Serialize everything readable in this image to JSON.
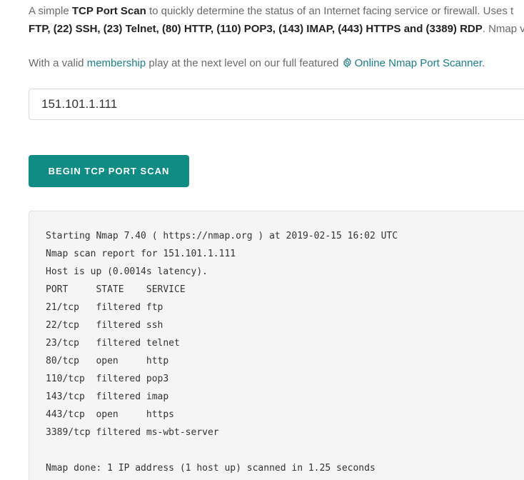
{
  "intro": {
    "t1": "A simple ",
    "b1": "TCP Port Scan",
    "t2": " to quickly determine the status of an Internet facing service or firewall. Uses t",
    "b2": "FTP, (22) SSH, (23) Telnet, (80) HTTP, (110) POP3, (143) IMAP, (443) HTTPS and (3389) RDP",
    "t3": ". Nmap ve"
  },
  "membership": {
    "t1": "With a valid ",
    "link": "membership",
    "t2": " play at the next level on our full featured ",
    "icon": "gear-icon",
    "scanner_link": "Online Nmap Port Scanner",
    "t3": "."
  },
  "target": {
    "value": "151.101.1.111"
  },
  "button": {
    "label": "BEGIN TCP PORT SCAN"
  },
  "output": {
    "lines": [
      "Starting Nmap 7.40 ( https://nmap.org ) at 2019-02-15 16:02 UTC",
      "Nmap scan report for 151.101.1.111",
      "Host is up (0.0014s latency).",
      "PORT     STATE    SERVICE",
      "21/tcp   filtered ftp",
      "22/tcp   filtered ssh",
      "23/tcp   filtered telnet",
      "80/tcp   open     http",
      "110/tcp  filtered pop3",
      "143/tcp  filtered imap",
      "443/tcp  open     https",
      "3389/tcp filtered ms-wbt-server",
      "",
      "Nmap done: 1 IP address (1 host up) scanned in 1.25 seconds"
    ]
  },
  "colors": {
    "accent": "#0f8c84",
    "link": "#1b7f86",
    "output_bg": "#f5f5f5"
  }
}
